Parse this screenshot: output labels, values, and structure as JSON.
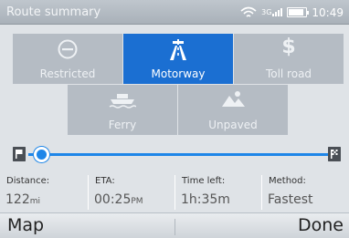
{
  "statusbar": {
    "title": "Route summary",
    "clock": "10:49",
    "signal_label": "3G",
    "battery_level": 0.9
  },
  "options": [
    {
      "label": "Restricted",
      "icon": "no-entry-icon",
      "selected": false
    },
    {
      "label": "Motorway",
      "icon": "motorway-icon",
      "selected": true
    },
    {
      "label": "Toll road",
      "icon": "dollar-icon",
      "selected": false
    },
    {
      "label": "Ferry",
      "icon": "ferry-icon",
      "selected": false
    },
    {
      "label": "Unpaved",
      "icon": "unpaved-road-icon",
      "selected": false
    }
  ],
  "route": {
    "progress": 0.0
  },
  "info": {
    "distance_label": "Distance:",
    "distance_value": "122",
    "distance_unit": "mi",
    "eta_label": "ETA:",
    "eta_value": "00:25",
    "eta_suffix": "PM",
    "time_left_label": "Time left:",
    "time_left_value": "1h:35m",
    "method_label": "Method:",
    "method_value": "Fastest"
  },
  "bottombar": {
    "left_label": "Map",
    "right_label": "Done"
  },
  "colors": {
    "accent": "#1b6fd2",
    "tile": "#b5bcc4",
    "background": "#dfe3e7"
  }
}
